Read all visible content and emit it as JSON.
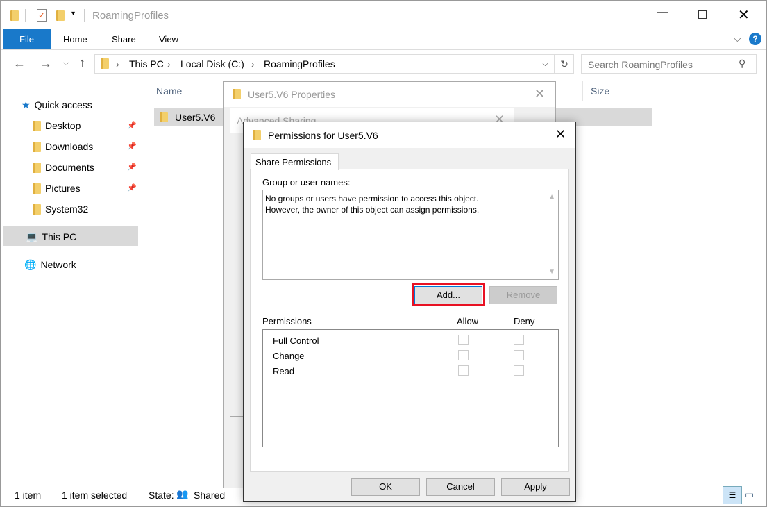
{
  "window": {
    "title": "RoamingProfiles"
  },
  "ribbon": {
    "tabs": [
      "File",
      "Home",
      "Share",
      "View"
    ]
  },
  "address": {
    "crumbs": [
      "This PC",
      "Local Disk (C:)",
      "RoamingProfiles"
    ],
    "search_placeholder": "Search RoamingProfiles"
  },
  "nav": {
    "items": [
      {
        "label": "Quick access",
        "icon": "star-icon"
      },
      {
        "label": "Desktop",
        "icon": "desktop-folder-icon",
        "pinned": true
      },
      {
        "label": "Downloads",
        "icon": "downloads-folder-icon",
        "pinned": true
      },
      {
        "label": "Documents",
        "icon": "documents-folder-icon",
        "pinned": true
      },
      {
        "label": "Pictures",
        "icon": "pictures-folder-icon",
        "pinned": true
      },
      {
        "label": "System32",
        "icon": "folder-icon"
      },
      {
        "label": "This PC",
        "icon": "computer-icon",
        "selected": true
      },
      {
        "label": "Network",
        "icon": "network-icon"
      }
    ]
  },
  "files": {
    "columns": [
      "Name",
      "Size"
    ],
    "rows": [
      {
        "name": "User5.V6"
      }
    ]
  },
  "status": {
    "count": "1 item",
    "selected": "1 item selected",
    "state_label": "State:",
    "state_value": "Shared"
  },
  "properties_dialog": {
    "title": "User5.V6 Properties"
  },
  "advanced_dialog": {
    "title": "Advanced Sharing"
  },
  "perm_dialog": {
    "title": "Permissions for User5.V6",
    "tab": "Share Permissions",
    "group_label": "Group or user names:",
    "message_line1": "No groups or users have permission to access this object.",
    "message_line2": "However, the owner of this object can assign permissions.",
    "add": "Add...",
    "remove": "Remove",
    "perm_label": "Permissions",
    "allow": "Allow",
    "deny": "Deny",
    "permissions": [
      {
        "name": "Full Control",
        "allow": false,
        "deny": false
      },
      {
        "name": "Change",
        "allow": false,
        "deny": false
      },
      {
        "name": "Read",
        "allow": false,
        "deny": false
      }
    ],
    "ok": "OK",
    "cancel": "Cancel",
    "apply": "Apply"
  },
  "colors": {
    "accent": "#1979ca",
    "highlight": "#e81123"
  }
}
